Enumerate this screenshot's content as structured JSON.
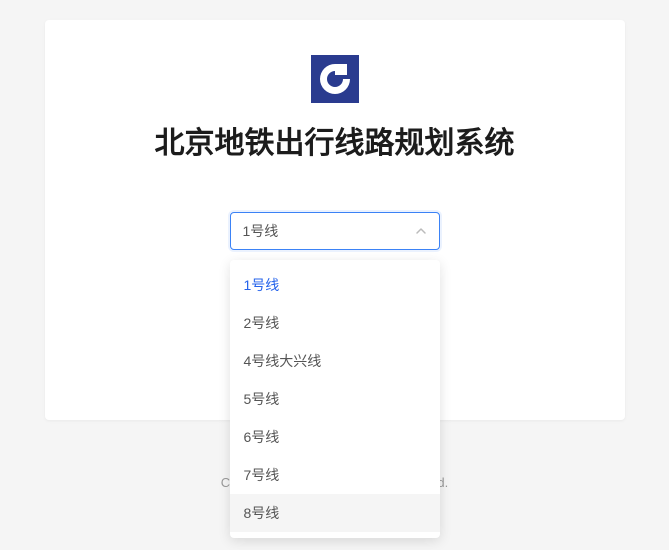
{
  "title": "北京地铁出行线路规划系统",
  "select": {
    "value": "1号线",
    "options": [
      "1号线",
      "2号线",
      "4号线大兴线",
      "5号线",
      "6号线",
      "7号线",
      "8号线"
    ],
    "selectedIndex": 0,
    "hoveredIndex": 6
  },
  "footer": {
    "left": "C",
    "right": "d."
  }
}
